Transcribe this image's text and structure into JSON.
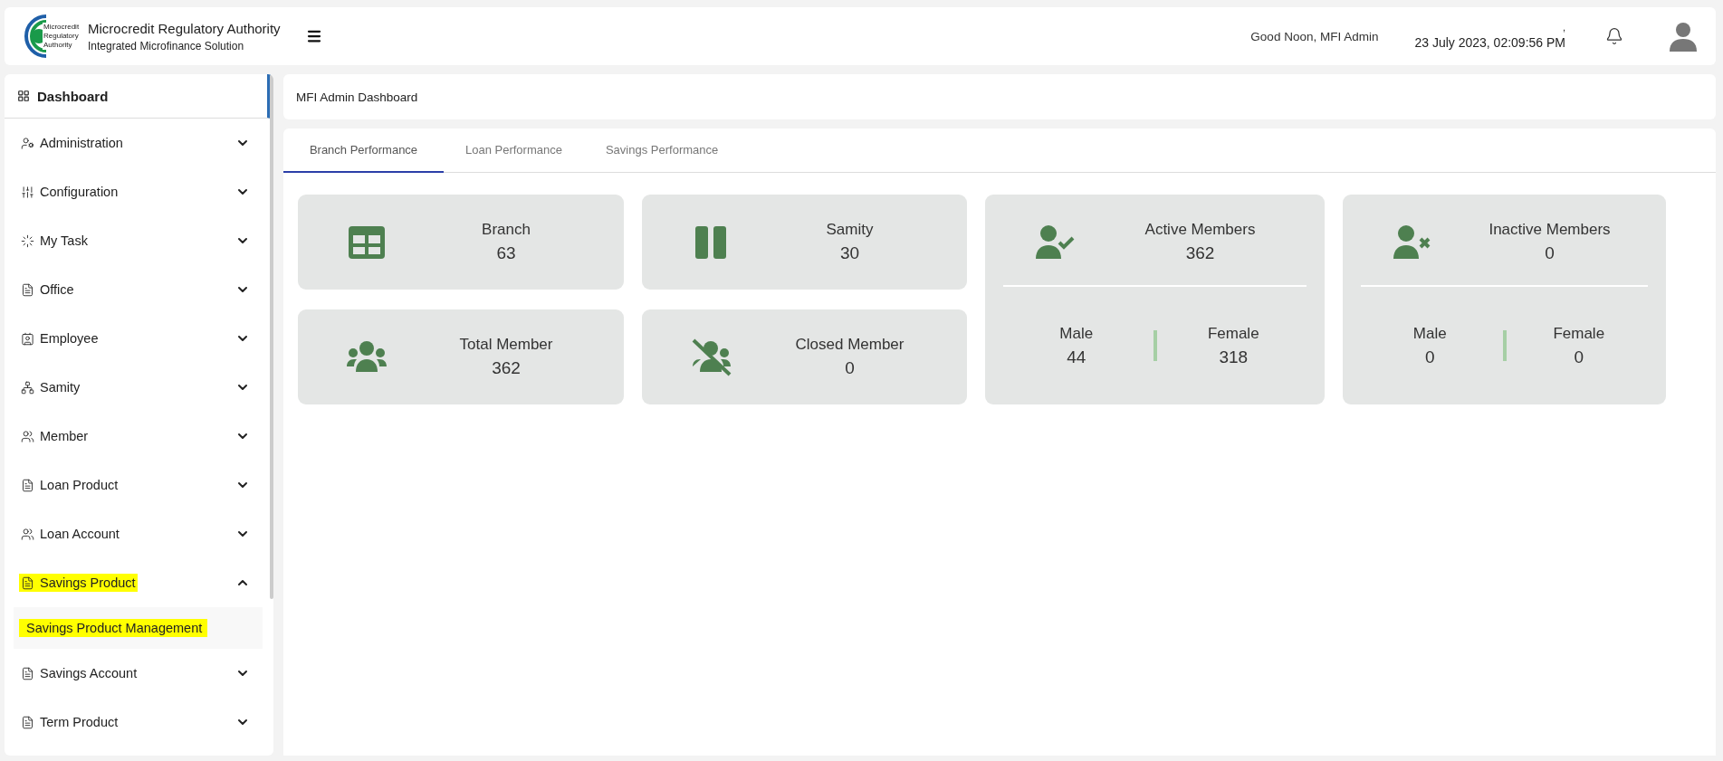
{
  "header": {
    "org_name": "Microcredit Regulatory Authority",
    "app_name": "Integrated Microfinance Solution",
    "logo_text": [
      "Microcredit",
      "Regulatory",
      "Authority"
    ],
    "greeting": "Good Noon, MFI Admin",
    "date_mark": ",",
    "datetime": "23 July 2023, 02:09:56 PM"
  },
  "sidebar": {
    "dashboard": {
      "label": "Dashboard",
      "selected": true
    },
    "items": [
      {
        "label": "Administration",
        "expanded": false,
        "highlighted": false
      },
      {
        "label": "Configuration",
        "expanded": false,
        "highlighted": false
      },
      {
        "label": "My Task",
        "expanded": false,
        "highlighted": false
      },
      {
        "label": "Office",
        "expanded": false,
        "highlighted": false
      },
      {
        "label": "Employee",
        "expanded": false,
        "highlighted": false
      },
      {
        "label": "Samity",
        "expanded": false,
        "highlighted": false
      },
      {
        "label": "Member",
        "expanded": false,
        "highlighted": false
      },
      {
        "label": "Loan Product",
        "expanded": false,
        "highlighted": false
      },
      {
        "label": "Loan Account",
        "expanded": false,
        "highlighted": false
      },
      {
        "label": "Savings Product",
        "expanded": true,
        "highlighted": true,
        "children": [
          {
            "label": "Savings Product Management",
            "highlighted": true
          }
        ]
      },
      {
        "label": "Savings Account",
        "expanded": false,
        "highlighted": false
      },
      {
        "label": "Term Product",
        "expanded": false,
        "highlighted": false
      }
    ]
  },
  "breadcrumb": "MFI Admin Dashboard",
  "tabs": [
    {
      "label": "Branch Performance",
      "selected": true
    },
    {
      "label": "Loan Performance",
      "selected": false
    },
    {
      "label": "Savings Performance",
      "selected": false
    }
  ],
  "cards": [
    {
      "kind": "simple",
      "label": "Branch",
      "value": "63"
    },
    {
      "kind": "simple",
      "label": "Samity",
      "value": "30"
    },
    {
      "kind": "split",
      "label": "Active Members",
      "value": "362",
      "male_label": "Male",
      "male": "44",
      "female_label": "Female",
      "female": "318"
    },
    {
      "kind": "split",
      "label": "Inactive Members",
      "value": "0",
      "male_label": "Male",
      "male": "0",
      "female_label": "Female",
      "female": "0"
    },
    {
      "kind": "simple",
      "label": "Total Member",
      "value": "362"
    },
    {
      "kind": "simple",
      "label": "Closed Member",
      "value": "0"
    }
  ]
}
